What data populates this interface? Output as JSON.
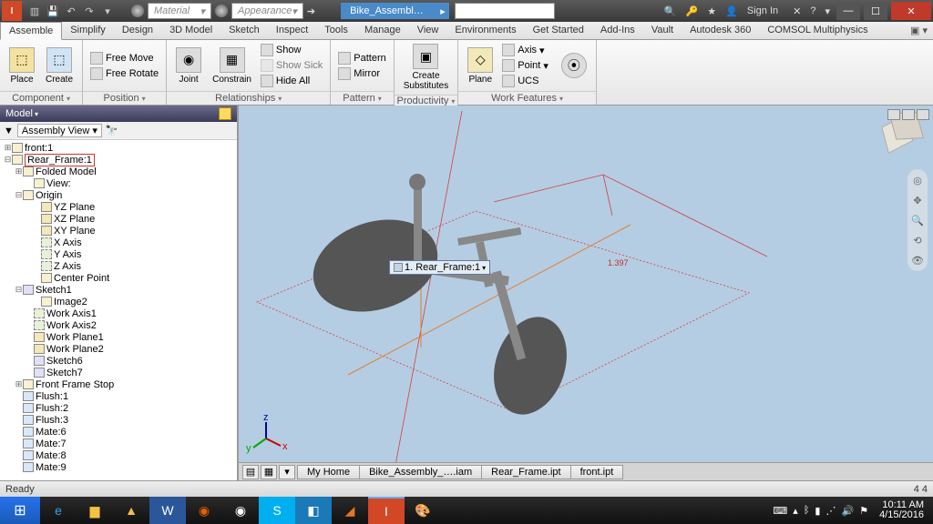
{
  "title_doc": "Bike_Assembl…",
  "material_placeholder": "Material",
  "appearance_placeholder": "Appearance",
  "sign_in": "Sign In",
  "ribbon_tabs": [
    "Assemble",
    "Simplify",
    "Design",
    "3D Model",
    "Sketch",
    "Inspect",
    "Tools",
    "Manage",
    "View",
    "Environments",
    "Get Started",
    "Add-Ins",
    "Vault",
    "Autodesk 360",
    "COMSOL Multiphysics"
  ],
  "panels": {
    "component": "Component",
    "position": "Position",
    "relationships": "Relationships",
    "pattern": "Pattern",
    "productivity": "Productivity",
    "work": "Work Features"
  },
  "btn": {
    "place": "Place",
    "create": "Create",
    "free_move": "Free Move",
    "free_rotate": "Free Rotate",
    "joint": "Joint",
    "constrain": "Constrain",
    "show": "Show",
    "show_sick": "Show Sick",
    "hide_all": "Hide All",
    "pattern": "Pattern",
    "mirror": "Mirror",
    "create_subs": "Create\nSubstitutes",
    "plane": "Plane",
    "axis": "Axis",
    "point": "Point",
    "ucs": "UCS"
  },
  "model_hdr": "Model",
  "assembly_view": "Assembly View",
  "tree": {
    "front1": "front:1",
    "rear_frame": "Rear_Frame:1",
    "folded": "Folded Model",
    "view": "View:",
    "origin": "Origin",
    "yz": "YZ Plane",
    "xz": "XZ Plane",
    "xy": "XY Plane",
    "xaxis": "X Axis",
    "yaxis": "Y Axis",
    "zaxis": "Z Axis",
    "center": "Center Point",
    "sketch1": "Sketch1",
    "image2": "Image2",
    "wa1": "Work Axis1",
    "wa2": "Work Axis2",
    "wp1": "Work Plane1",
    "wp2": "Work Plane2",
    "sketch6": "Sketch6",
    "sketch7": "Sketch7",
    "ffs": "Front Frame Stop",
    "flush1": "Flush:1",
    "flush2": "Flush:2",
    "flush3": "Flush:3",
    "mate6": "Mate:6",
    "mate7": "Mate:7",
    "mate8": "Mate:8",
    "mate9": "Mate:9"
  },
  "vp_label": "1. Rear_Frame:1",
  "vp_dim": "1.397",
  "doc_tabs": [
    "My Home",
    "Bike_Assembly_….iam",
    "Rear_Frame.ipt",
    "front.ipt"
  ],
  "status_left": "Ready",
  "status_right": "4   4",
  "clock_time": "10:11 AM",
  "clock_date": "4/15/2016"
}
